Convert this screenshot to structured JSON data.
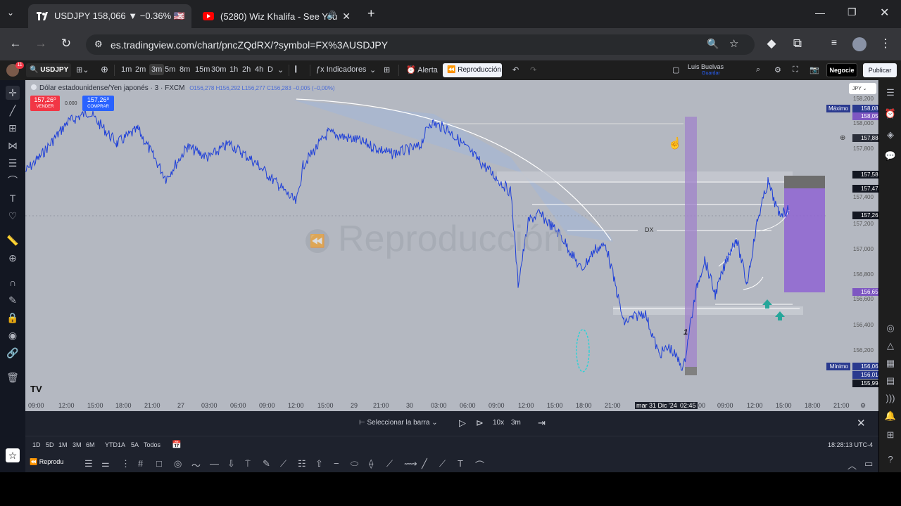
{
  "browser": {
    "tabs": [
      {
        "title": "USDJPY 158,066 ▼ −0.36% 🇺🇸",
        "icon": "tradingview-icon"
      },
      {
        "title": "(5280) Wiz Khalifa - See You",
        "icon": "youtube-icon"
      }
    ],
    "url": "es.tradingview.com/chart/pncZQdRX/?symbol=FX%3AUSDJPY"
  },
  "toolbar": {
    "symbol": "USDJPY",
    "intervals": [
      "1m",
      "2m",
      "3m",
      "5m",
      "8m",
      "15m",
      "30m",
      "1h",
      "2h",
      "4h",
      "D"
    ],
    "active_interval": "3m",
    "indicators_label": "Indicadores",
    "alert_label": "Alerta",
    "replay_label": "Reproducción",
    "user_name": "Luis Buelvas",
    "user_sub": "Guardar",
    "trade_label": "Negocie",
    "publish_label": "Publicar",
    "notification_count": "11"
  },
  "legend": {
    "title": "Dólar estadounidense/Yen japonés · 3 · FXCM",
    "ohlc": "O156,278  H156,292  L156,277  C156,283  −0,005 (−0,00%)",
    "sell_price": "157,26⁰",
    "sell_label": "VENDER",
    "spread": "0.000",
    "buy_price": "157,26⁰",
    "buy_label": "COMPRAR"
  },
  "watermark": "Reproducción",
  "annotations": {
    "dx_label": "DX",
    "marker_label": "1"
  },
  "chart_data": {
    "type": "line",
    "symbol": "USDJPY",
    "currency": "JPY",
    "price_labels": [
      {
        "label": "Máximo",
        "value": "158,082",
        "color": "#2a3a8f"
      },
      {
        "label": "",
        "value": "158,056",
        "color": "#7e57c2"
      },
      {
        "label": "",
        "value": "157,884",
        "color": "#2a2e39"
      },
      {
        "label": "",
        "value": "157,586",
        "color": "#131722"
      },
      {
        "label": "",
        "value": "157,478",
        "color": "#131722"
      },
      {
        "label": "",
        "value": "157,265",
        "color": "#131722"
      },
      {
        "label": "",
        "value": "156,656",
        "color": "#7e57c2"
      },
      {
        "label": "Mínimo",
        "value": "156,063",
        "color": "#2a3a8f"
      },
      {
        "label": "",
        "value": "156,014",
        "color": "#2a3a8f"
      },
      {
        "label": "",
        "value": "155,994",
        "color": "#131722"
      }
    ],
    "y_ticks": [
      "158,200",
      "158,000",
      "157,800",
      "157,400",
      "157,200",
      "157,000",
      "156,800",
      "156,600",
      "156,400",
      "156,200"
    ],
    "x_labels": [
      "09:00",
      "12:00",
      "15:00",
      "18:00",
      "21:00",
      "27",
      "03:00",
      "06:00",
      "09:00",
      "12:00",
      "15:00",
      "29",
      "21:00",
      "30",
      "03:00",
      "06:00",
      "09:00",
      "12:00",
      "15:00",
      "18:00",
      "21:00",
      "mar 31 Dic '24",
      "02:45",
      "00",
      "09:00",
      "12:00",
      "15:00",
      "18:00",
      "21:00"
    ]
  },
  "replay": {
    "select_bar": "Seleccionar la barra",
    "speed": "10x",
    "interval": "3m"
  },
  "timeframes": [
    "1D",
    "5D",
    "1M",
    "3M",
    "6M",
    "YTD",
    "1A",
    "5A",
    "Todos"
  ],
  "clock": "18:28:13 UTC-4",
  "drawbar_label": "Reprodu"
}
